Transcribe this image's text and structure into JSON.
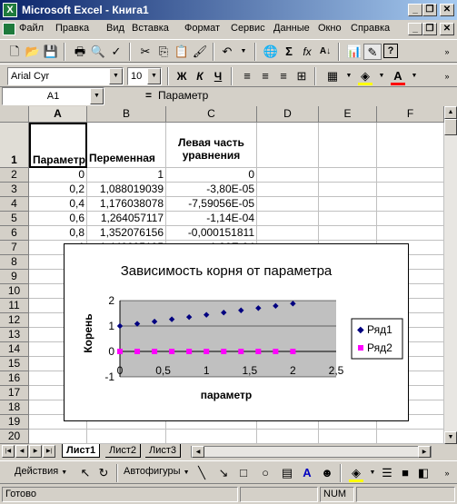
{
  "window": {
    "title": "Microsoft Excel - Книга1",
    "controls": {
      "minimize": "_",
      "restore": "❐",
      "close": "✕"
    }
  },
  "menu": {
    "items": [
      "Файл",
      "Правка",
      "Вид",
      "Вставка",
      "Формат",
      "Сервис",
      "Данные",
      "Окно",
      "Справка"
    ],
    "doc_controls": {
      "minimize": "_",
      "restore": "❐",
      "close": "✕"
    }
  },
  "format_toolbar": {
    "font": "Arial Cyr",
    "size": "10",
    "bold": "Ж",
    "italic": "К",
    "underline": "Ч"
  },
  "formula_bar": {
    "name_box": "A1",
    "equals": "=",
    "value": "Параметр"
  },
  "sheet": {
    "columns": [
      "A",
      "B",
      "C",
      "D",
      "E",
      "F"
    ],
    "rows": [
      "1",
      "2",
      "3",
      "4",
      "5",
      "6",
      "7",
      "8",
      "9",
      "10",
      "11",
      "12",
      "13",
      "14",
      "15",
      "16",
      "17",
      "18",
      "19",
      "20",
      "21"
    ],
    "header_row": {
      "a": "Параметр",
      "b": "Переменная",
      "c_line1": "Левая часть",
      "c_line2": "уравнения"
    },
    "data": [
      [
        "0",
        "1",
        "0"
      ],
      [
        "0,2",
        "1,088019039",
        "-3,80E-05"
      ],
      [
        "0,4",
        "1,176038078",
        "-7,59056E-05"
      ],
      [
        "0,6",
        "1,264057117",
        "-1,14E-04"
      ],
      [
        "0,8",
        "1,352076156",
        "-0,000151811"
      ],
      [
        "1",
        "1,440095195",
        "-1,90E-04"
      ]
    ]
  },
  "chart_data": {
    "type": "scatter",
    "title": "Зависимость корня от параметра",
    "xlabel": "параметр",
    "ylabel": "Корень",
    "xlim": [
      0,
      2.5
    ],
    "ylim": [
      -1,
      2
    ],
    "x_ticks": [
      "0",
      "0,5",
      "1",
      "1,5",
      "2",
      "2,5"
    ],
    "y_ticks": [
      "2",
      "1",
      "0",
      "-1"
    ],
    "grid": true,
    "legend": "right",
    "series": [
      {
        "name": "Ряд1",
        "marker": "diamond",
        "color": "#000080",
        "x": [
          0,
          0.2,
          0.4,
          0.6,
          0.8,
          1.0,
          1.2,
          1.4,
          1.6,
          1.8,
          2.0
        ],
        "y": [
          1.0,
          1.088,
          1.176,
          1.264,
          1.352,
          1.44,
          1.528,
          1.616,
          1.704,
          1.792,
          1.88
        ]
      },
      {
        "name": "Ряд2",
        "marker": "square",
        "color": "#ff00ff",
        "x": [
          0,
          0.2,
          0.4,
          0.6,
          0.8,
          1.0,
          1.2,
          1.4,
          1.6,
          1.8,
          2.0
        ],
        "y": [
          0,
          0,
          0,
          0,
          0,
          0,
          0,
          0,
          0,
          0,
          0
        ]
      }
    ],
    "plot_area_color": "#c0c0c0"
  },
  "tabs": {
    "sheets": [
      "Лист1",
      "Лист2",
      "Лист3"
    ],
    "active": "Лист1"
  },
  "drawing_toolbar": {
    "actions": "Действия",
    "autoshapes": "Автофигуры"
  },
  "status": {
    "text": "Готово",
    "num": "NUM"
  }
}
